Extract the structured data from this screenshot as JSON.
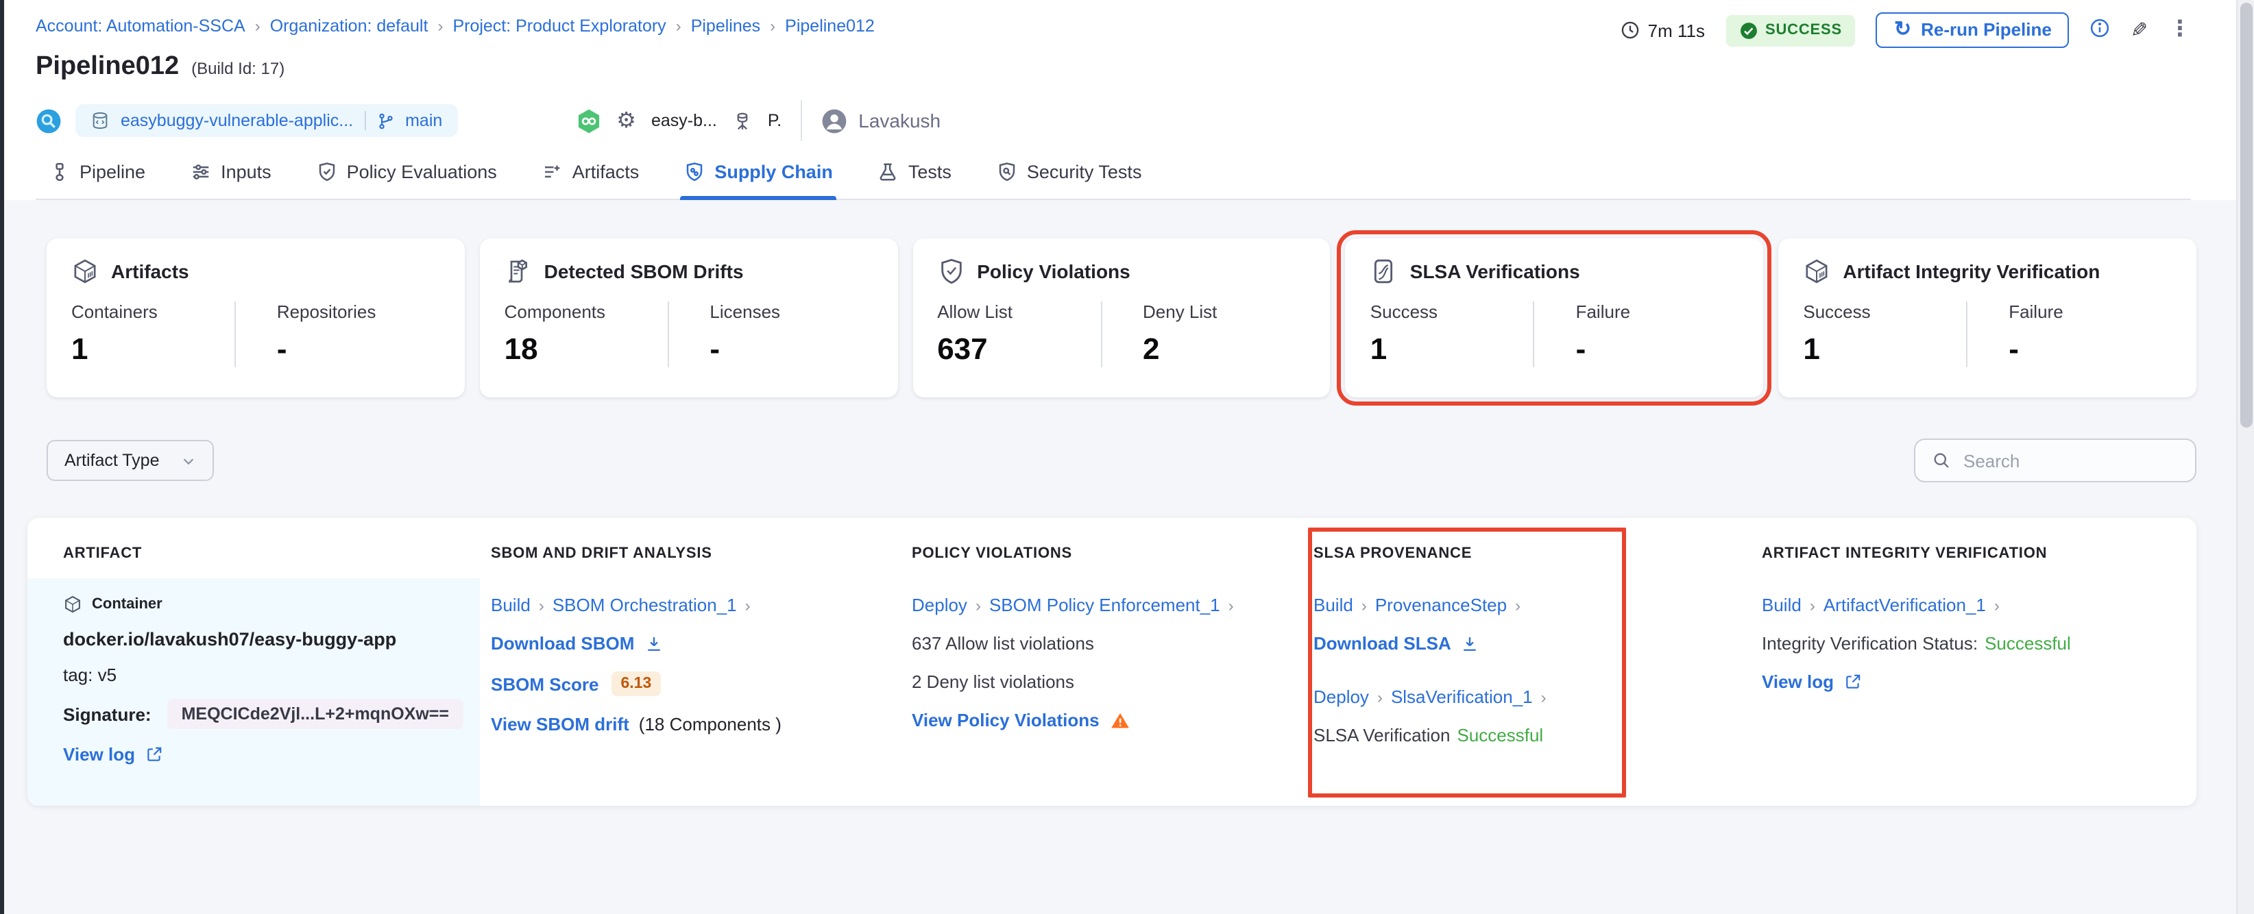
{
  "ui": {
    "sep": "›",
    "icons": {
      "kebab": "⋮",
      "pencil": "✎",
      "gear": "⚙",
      "refresh": "↻"
    }
  },
  "breadcrumb": {
    "items": [
      "Account: Automation-SSCA",
      "Organization: default",
      "Project: Product Exploratory",
      "Pipelines",
      "Pipeline012"
    ]
  },
  "header": {
    "title": "Pipeline012",
    "build_id": "(Build Id: 17)",
    "duration": "7m 11s",
    "status": "SUCCESS",
    "rerun_label": "Re-run Pipeline",
    "repo_name": "easybuggy-vulnerable-applic...",
    "branch": "main",
    "trigger_name": "easy-b...",
    "trigger_initial": "P.",
    "user_name": "Lavakush"
  },
  "tabs": [
    {
      "label": "Pipeline"
    },
    {
      "label": "Inputs"
    },
    {
      "label": "Policy Evaluations"
    },
    {
      "label": "Artifacts"
    },
    {
      "label": "Supply Chain",
      "active": true
    },
    {
      "label": "Tests"
    },
    {
      "label": "Security Tests"
    }
  ],
  "summary_cards": [
    {
      "title": "Artifacts",
      "metrics": [
        {
          "label": "Containers",
          "value": "1"
        },
        {
          "label": "Repositories",
          "value": "-"
        }
      ]
    },
    {
      "title": "Detected SBOM Drifts",
      "metrics": [
        {
          "label": "Components",
          "value": "18"
        },
        {
          "label": "Licenses",
          "value": "-"
        }
      ]
    },
    {
      "title": "Policy Violations",
      "metrics": [
        {
          "label": "Allow List",
          "value": "637"
        },
        {
          "label": "Deny List",
          "value": "2"
        }
      ]
    },
    {
      "title": "SLSA Verifications",
      "highlighted": true,
      "metrics": [
        {
          "label": "Success",
          "value": "1"
        },
        {
          "label": "Failure",
          "value": "-"
        }
      ]
    },
    {
      "title": "Artifact Integrity Verification",
      "metrics": [
        {
          "label": "Success",
          "value": "1"
        },
        {
          "label": "Failure",
          "value": "-"
        }
      ]
    }
  ],
  "filters": {
    "artifact_type_label": "Artifact Type",
    "search_placeholder": "Search"
  },
  "table": {
    "columns": [
      "ARTIFACT",
      "SBOM AND DRIFT ANALYSIS",
      "POLICY VIOLATIONS",
      "SLSA PROVENANCE",
      "ARTIFACT INTEGRITY VERIFICATION"
    ],
    "row": {
      "artifact": {
        "type_label": "Container",
        "image": "docker.io/lavakush07/easy-buggy-app",
        "tag": "tag: v5",
        "signature_label": "Signature:",
        "signature_value": "MEQCICde2Vjl...L+2+mqnOXw==",
        "view_log_label": "View log"
      },
      "sbom": {
        "stage": "Build",
        "step": "SBOM Orchestration_1",
        "download_label": "Download SBOM",
        "score_label": "SBOM Score",
        "score_value": "6.13",
        "drift_link": "View SBOM drift",
        "drift_note": "(18 Components )"
      },
      "policy": {
        "stage": "Deploy",
        "step": "SBOM Policy Enforcement_1",
        "allow_text": "637 Allow list violations",
        "deny_text": "2 Deny list violations",
        "view_link": "View Policy Violations"
      },
      "slsa": {
        "stage_1": "Build",
        "step_1": "ProvenanceStep",
        "download_label": "Download SLSA",
        "stage_2": "Deploy",
        "step_2": "SlsaVerification_1",
        "status_label": "SLSA Verification",
        "status_value": "Successful"
      },
      "integrity": {
        "stage": "Build",
        "step": "ArtifactVerification_1",
        "status_label": "Integrity Verification Status:",
        "status_value": "Successful",
        "view_log_label": "View log"
      }
    }
  },
  "colors": {
    "accent_blue": "#2B6FD9",
    "success_green": "#42AB45",
    "status_badge_bg": "#E2F6E0",
    "status_badge_text": "#1C7E2E",
    "annotation_red": "#E8442E",
    "warning_orange": "#FF7020",
    "score_orange": "#C05809",
    "score_badge_bg": "#FBEEDC"
  }
}
